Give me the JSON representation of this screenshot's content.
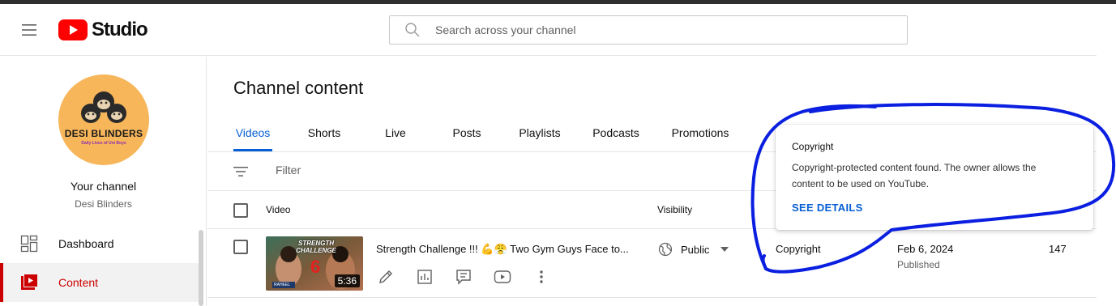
{
  "header": {
    "app_name": "Studio",
    "search_placeholder": "Search across your channel"
  },
  "sidebar": {
    "avatar_title": "DESI BLINDERS",
    "avatar_subtitle": "Daily Lives of Uni Boys",
    "your_channel_label": "Your channel",
    "channel_name": "Desi Blinders",
    "items": [
      {
        "label": "Dashboard",
        "icon": "dashboard-icon",
        "active": false
      },
      {
        "label": "Content",
        "icon": "content-icon",
        "active": true
      }
    ]
  },
  "main": {
    "title": "Channel content",
    "tabs": [
      {
        "label": "Videos",
        "active": true
      },
      {
        "label": "Shorts"
      },
      {
        "label": "Live"
      },
      {
        "label": "Posts"
      },
      {
        "label": "Playlists"
      },
      {
        "label": "Podcasts"
      },
      {
        "label": "Promotions"
      }
    ],
    "filter_placeholder": "Filter",
    "columns": {
      "video": "Video",
      "visibility": "Visibility"
    },
    "rows": [
      {
        "title": "Strength Challenge !!! 💪😤 Two Gym Guys Face to...",
        "duration": "5:36",
        "thumb_text": "STRENGTH CHALLENGE",
        "thumb_caption": "RAHEEL",
        "visibility": "Public",
        "restrictions": "Copyright",
        "date": "Feb 6, 2024",
        "date_status": "Published",
        "views": "147"
      }
    ]
  },
  "tooltip": {
    "title": "Copyright",
    "body": "Copyright-protected content found. The owner allows the content to be used on YouTube.",
    "link": "SEE DETAILS"
  },
  "colors": {
    "accent": "#065fd4",
    "brand_red": "#ff0000",
    "active_red": "#cc0000",
    "annotation_blue": "#0a1fe0"
  }
}
